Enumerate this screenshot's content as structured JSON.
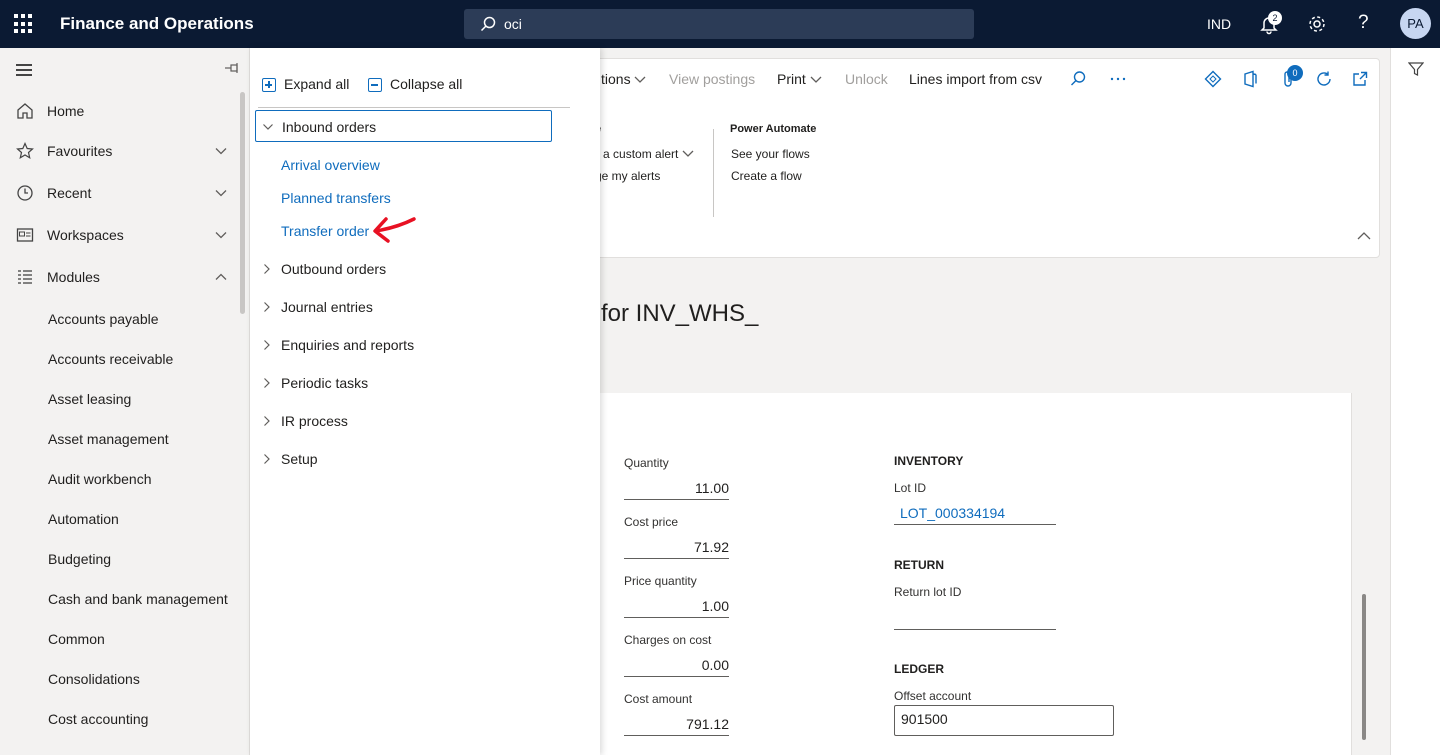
{
  "topbar": {
    "app_title": "Finance and Operations",
    "search_value": "oci",
    "company": "IND",
    "notification_count": "2",
    "help": "?",
    "avatar": "PA"
  },
  "leftnav": {
    "items": [
      {
        "label": "Home",
        "icon": "home-icon"
      },
      {
        "label": "Favourites",
        "icon": "star-icon"
      },
      {
        "label": "Recent",
        "icon": "clock-icon"
      },
      {
        "label": "Workspaces",
        "icon": "workspace-icon"
      },
      {
        "label": "Modules",
        "icon": "list-icon"
      }
    ],
    "modules": [
      "Accounts payable",
      "Accounts receivable",
      "Asset leasing",
      "Asset management",
      "Audit workbench",
      "Automation",
      "Budgeting",
      "Cash and bank management",
      "Common",
      "Consolidations",
      "Cost accounting"
    ]
  },
  "actionpane": {
    "tabs": {
      "options": "tions",
      "view_postings": "View postings",
      "print": "Print",
      "unlock": "Unlock",
      "lines_import": "Lines import from csv"
    },
    "attach_count": "0",
    "alerts_partial_heading": "e",
    "alerts_custom": "e a custom alert",
    "alerts_manage": "ge my alerts",
    "power_automate": {
      "heading": "Power Automate",
      "see_flows": "See your flows",
      "create_flow": "Create a flow"
    }
  },
  "form": {
    "title": "for INV_WHS_",
    "fields": {
      "quantity_label": "Quantity",
      "quantity": "11.00",
      "cost_price_label": "Cost price",
      "cost_price": "71.92",
      "price_quantity_label": "Price quantity",
      "price_quantity": "1.00",
      "charges_label": "Charges on cost",
      "charges": "0.00",
      "cost_amount_label": "Cost amount",
      "cost_amount": "791.12"
    },
    "inventory": {
      "heading": "INVENTORY",
      "lot_id_label": "Lot ID",
      "lot_id": "LOT_000334194"
    },
    "return": {
      "heading": "RETURN",
      "return_lot_label": "Return lot ID"
    },
    "ledger": {
      "heading": "LEDGER",
      "offset_label": "Offset account",
      "offset_value": "901500"
    }
  },
  "flyout": {
    "expand_all": "Expand all",
    "collapse_all": "Collapse all",
    "groups": [
      {
        "label": "Inbound orders",
        "expanded": true
      },
      {
        "label": "Outbound orders"
      },
      {
        "label": "Journal entries"
      },
      {
        "label": "Enquiries and reports"
      },
      {
        "label": "Periodic tasks"
      },
      {
        "label": "IR process"
      },
      {
        "label": "Setup"
      }
    ],
    "inbound_links": [
      "Arrival overview",
      "Planned transfers",
      "Transfer order"
    ]
  },
  "colors": {
    "topbar": "#0b1a33",
    "link": "#0f6cbd",
    "annotation_arrow": "#e81123"
  }
}
